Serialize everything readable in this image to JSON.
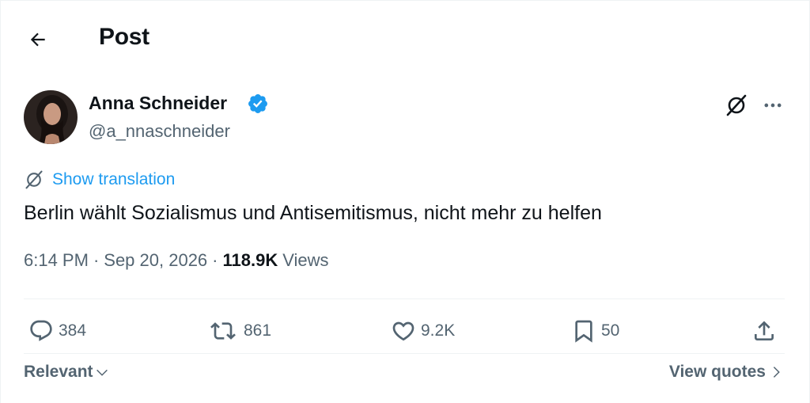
{
  "header": {
    "title": "Post",
    "back_icon": "arrow-left-icon"
  },
  "author": {
    "name": "Anna Schneider",
    "handle": "@a_nnaschneider",
    "verified": true,
    "verified_color": "#1d9bf0"
  },
  "translation": {
    "label": "Show translation",
    "icon": "grok-icon"
  },
  "post": {
    "text": "Berlin wählt Sozialismus und Antisemitismus, nicht mehr zu helfen"
  },
  "meta": {
    "time": "6:14 PM",
    "separator": "·",
    "date": "Sep 20, 2026",
    "views_count": "118.9K",
    "views_label": "Views"
  },
  "actions": {
    "replies": "384",
    "reposts": "861",
    "likes": "9.2K",
    "bookmarks": "50"
  },
  "footer": {
    "sort_label": "Relevant",
    "view_quotes_label": "View quotes"
  },
  "colors": {
    "accent": "#1d9bf0",
    "text": "#0f1419",
    "secondary": "#536471",
    "divider": "#eff3f4"
  }
}
